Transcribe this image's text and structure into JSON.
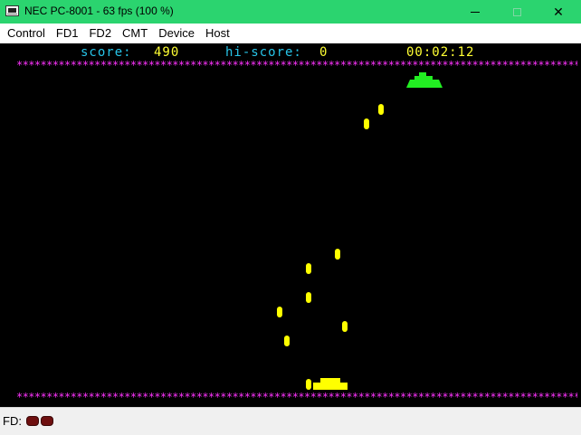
{
  "window": {
    "title": "NEC PC-8001 - 63 fps (100 %)",
    "app_icon": "computer-icon",
    "controls": {
      "minimize": "minimize-icon",
      "maximize": "maximize-icon",
      "close": "✕"
    }
  },
  "menu": {
    "items": [
      "Control",
      "FD1",
      "FD2",
      "CMT",
      "Device",
      "Host"
    ]
  },
  "game": {
    "score_label": "score:",
    "score_value": "490",
    "hiscore_label": "hi-score:",
    "hiscore_value": "0",
    "timer": "00:02:12",
    "border_pattern": "******************************************************************************************************************",
    "colors": {
      "background": "#000000",
      "hud_label": "#27c4e8",
      "hud_value": "#ffff33",
      "border": "#ff33ff",
      "enemy": "#22ee22",
      "player": "#ffff00"
    }
  },
  "status": {
    "fd_label": "FD:",
    "fd_leds": [
      "fd-led-1",
      "fd-led-2"
    ],
    "led_color": "#6e0f0f"
  }
}
